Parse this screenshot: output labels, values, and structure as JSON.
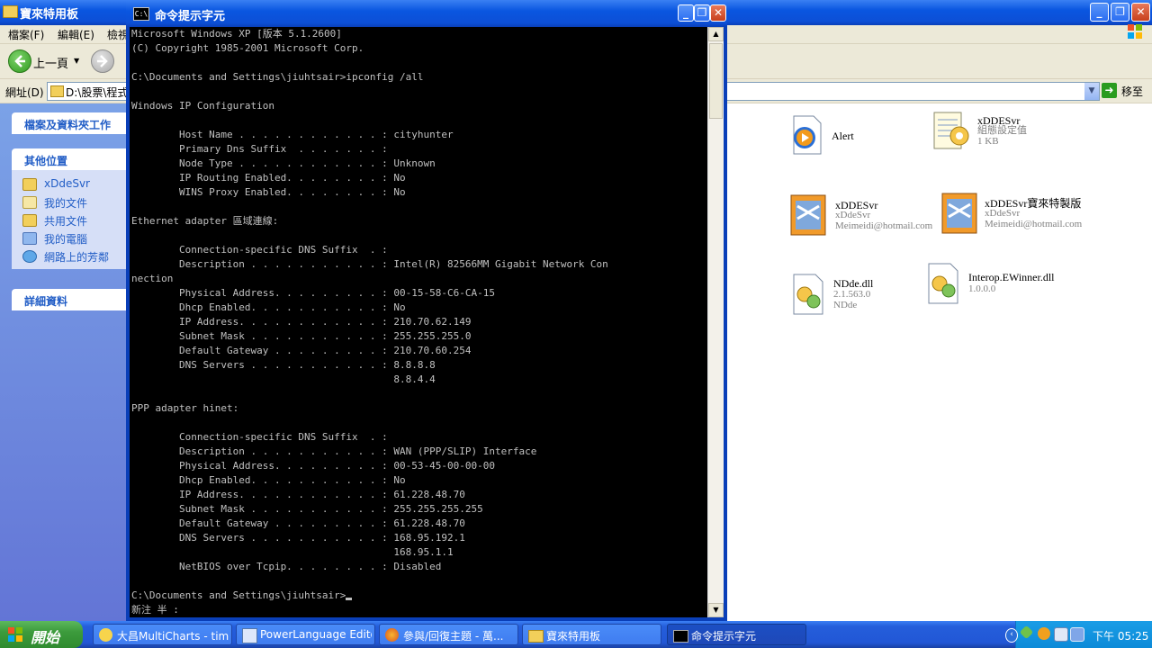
{
  "explorer": {
    "title": "寶來特用板",
    "menu": [
      "檔案(F)",
      "編輯(E)",
      "檢視"
    ],
    "toolbar": {
      "back_label": "上一頁"
    },
    "address": {
      "label": "網址(D)",
      "value": "D:\\股票\\程式\\",
      "go_label": "移至"
    },
    "left_panel": {
      "tasks_header": "檔案及資料夾工作",
      "other_places_header": "其他位置",
      "places": [
        "xDdeSvr",
        "我的文件",
        "共用文件",
        "我的電腦",
        "網路上的芳鄰"
      ],
      "details_header": "詳細資料"
    },
    "files": [
      {
        "name": "Alert",
        "icon": "media-player-icon"
      },
      {
        "name": "xDDESvr",
        "lines": [
          "組態設定值",
          "1 KB"
        ],
        "icon": "config-file-icon"
      },
      {
        "name": "xDDESvr",
        "lines": [
          "xDdeSvr",
          "Meimeidi@hotmail.com"
        ],
        "icon": "app-icon"
      },
      {
        "name": "xDDESvr寶來特製版",
        "lines": [
          "xDdeSvr",
          "Meimeidi@hotmail.com"
        ],
        "icon": "app-icon"
      },
      {
        "name": "NDde.dll",
        "lines": [
          "2.1.563.0",
          "NDde"
        ],
        "icon": "dll-icon"
      },
      {
        "name": "Interop.EWinner.dll",
        "lines": [
          "1.0.0.0"
        ],
        "icon": "dll-icon"
      }
    ]
  },
  "cmd": {
    "title": "命令提示字元",
    "icon_text": "C:\\",
    "lines": [
      "Microsoft Windows XP [版本 5.1.2600]",
      "(C) Copyright 1985-2001 Microsoft Corp.",
      "",
      "C:\\Documents and Settings\\jiuhtsair>ipconfig /all",
      "",
      "Windows IP Configuration",
      "",
      "        Host Name . . . . . . . . . . . . : cityhunter",
      "        Primary Dns Suffix  . . . . . . . : ",
      "        Node Type . . . . . . . . . . . . : Unknown",
      "        IP Routing Enabled. . . . . . . . : No",
      "        WINS Proxy Enabled. . . . . . . . : No",
      "",
      "Ethernet adapter 區域連線:",
      "",
      "        Connection-specific DNS Suffix  . : ",
      "        Description . . . . . . . . . . . : Intel(R) 82566MM Gigabit Network Con",
      "nection",
      "        Physical Address. . . . . . . . . : 00-15-58-C6-CA-15",
      "        Dhcp Enabled. . . . . . . . . . . : No",
      "        IP Address. . . . . . . . . . . . : 210.70.62.149",
      "        Subnet Mask . . . . . . . . . . . : 255.255.255.0",
      "        Default Gateway . . . . . . . . . : 210.70.60.254",
      "        DNS Servers . . . . . . . . . . . : 8.8.8.8",
      "                                            8.8.4.4",
      "",
      "PPP adapter hinet:",
      "",
      "        Connection-specific DNS Suffix  . : ",
      "        Description . . . . . . . . . . . : WAN (PPP/SLIP) Interface",
      "        Physical Address. . . . . . . . . : 00-53-45-00-00-00",
      "        Dhcp Enabled. . . . . . . . . . . : No",
      "        IP Address. . . . . . . . . . . . : 61.228.48.70",
      "        Subnet Mask . . . . . . . . . . . : 255.255.255.255",
      "        Default Gateway . . . . . . . . . : 61.228.48.70",
      "        DNS Servers . . . . . . . . . . . : 168.95.192.1",
      "                                            168.95.1.1",
      "        NetBIOS over Tcpip. . . . . . . . : Disabled",
      "",
      "C:\\Documents and Settings\\jiuhtsair>",
      "新注 半 :"
    ]
  },
  "taskbar": {
    "start_label": "開始",
    "tasks": [
      {
        "label": "大昌MultiCharts - tim...",
        "active": false
      },
      {
        "label": "PowerLanguage Editor...",
        "active": false
      },
      {
        "label": "參與/回復主題 - 萬...",
        "active": false
      },
      {
        "label": "寶來特用板",
        "active": false
      },
      {
        "label": "命令提示字元",
        "active": true
      }
    ],
    "clock": "下午 05:25"
  },
  "colors": {
    "titlebar": "#0a56e0",
    "taskbar": "#245edb",
    "start": "#3c9b3c",
    "console_bg": "#000000",
    "console_fg": "#c0c0c0",
    "link": "#215dc6"
  }
}
